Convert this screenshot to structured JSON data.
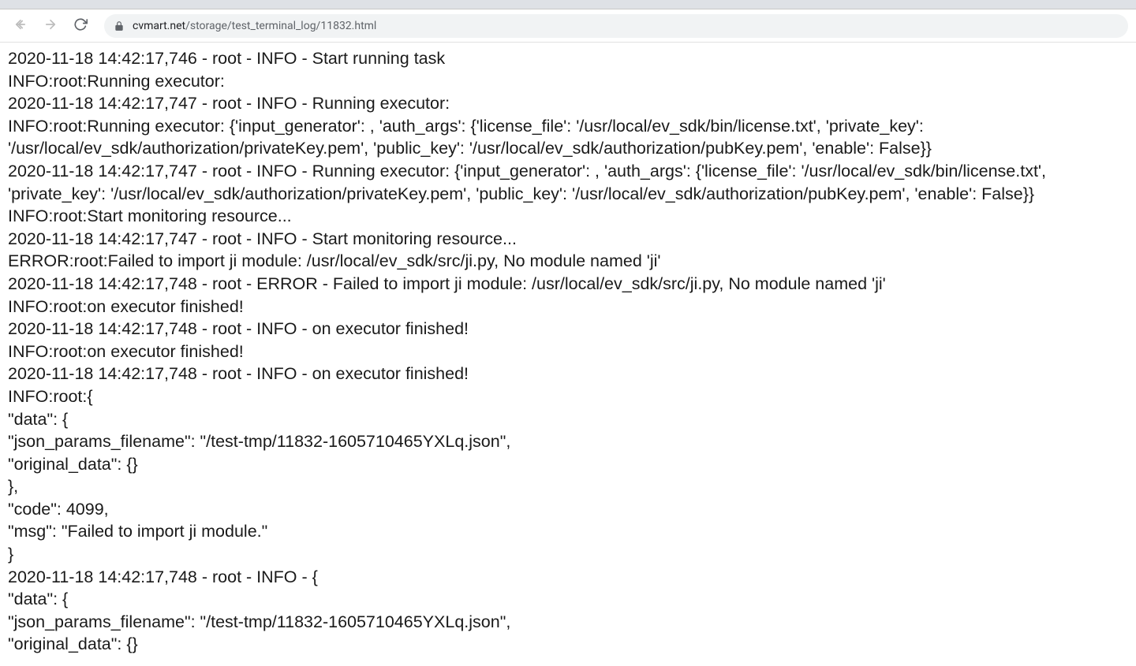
{
  "url": {
    "domain": "cvmart.net",
    "path": "/storage/test_terminal_log/11832.html"
  },
  "log_lines": [
    "2020-11-18 14:42:17,746 - root - INFO - Start running task",
    "INFO:root:Running executor:",
    "2020-11-18 14:42:17,747 - root - INFO - Running executor:",
    "INFO:root:Running executor: {'input_generator': , 'auth_args': {'license_file': '/usr/local/ev_sdk/bin/license.txt', 'private_key': '/usr/local/ev_sdk/authorization/privateKey.pem', 'public_key': '/usr/local/ev_sdk/authorization/pubKey.pem', 'enable': False}}",
    "2020-11-18 14:42:17,747 - root - INFO - Running executor: {'input_generator': , 'auth_args': {'license_file': '/usr/local/ev_sdk/bin/license.txt', 'private_key': '/usr/local/ev_sdk/authorization/privateKey.pem', 'public_key': '/usr/local/ev_sdk/authorization/pubKey.pem', 'enable': False}}",
    "INFO:root:Start monitoring resource...",
    "2020-11-18 14:42:17,747 - root - INFO - Start monitoring resource...",
    "ERROR:root:Failed to import ji module: /usr/local/ev_sdk/src/ji.py, No module named 'ji'",
    "2020-11-18 14:42:17,748 - root - ERROR - Failed to import ji module: /usr/local/ev_sdk/src/ji.py, No module named 'ji'",
    "INFO:root:on executor finished!",
    "2020-11-18 14:42:17,748 - root - INFO - on executor finished!",
    "INFO:root:on executor finished!",
    "2020-11-18 14:42:17,748 - root - INFO - on executor finished!",
    "INFO:root:{",
    "\"data\": {",
    "\"json_params_filename\": \"/test-tmp/11832-1605710465YXLq.json\",",
    "\"original_data\": {}",
    "},",
    "\"code\": 4099,",
    "\"msg\": \"Failed to import ji module.\"",
    "}",
    "2020-11-18 14:42:17,748 - root - INFO - {",
    "\"data\": {",
    "\"json_params_filename\": \"/test-tmp/11832-1605710465YXLq.json\",",
    "\"original_data\": {}"
  ]
}
